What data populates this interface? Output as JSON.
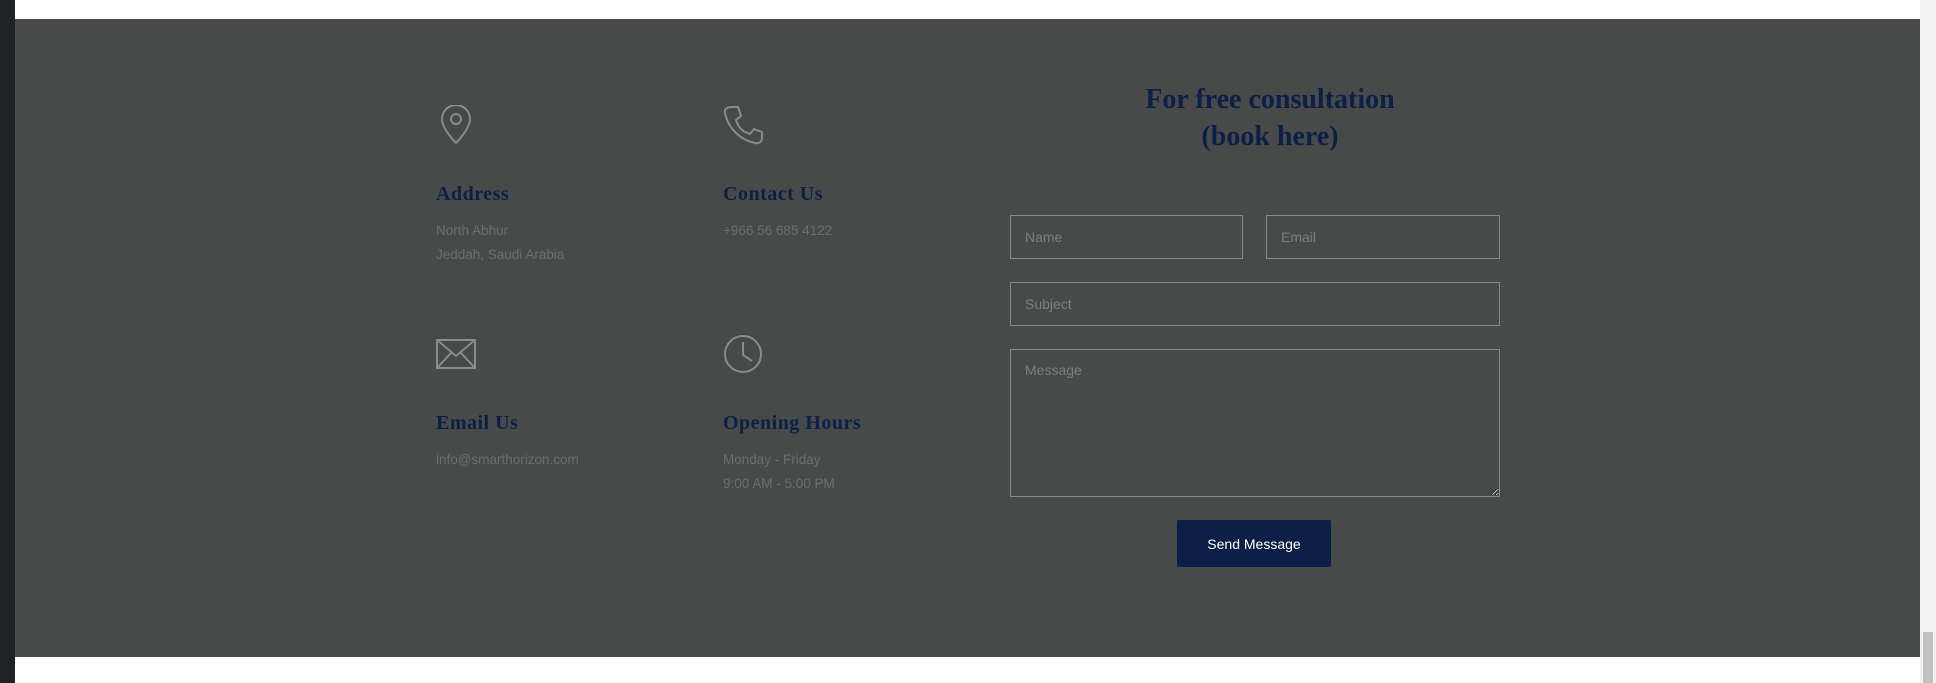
{
  "contact": {
    "address": {
      "icon": "location-pin-icon",
      "title": "Address",
      "lines": [
        "North Abhur",
        "Jeddah, Saudi Arabia"
      ]
    },
    "phone": {
      "icon": "phone-icon",
      "title": "Contact Us",
      "lines": [
        "+966 56 685 4122"
      ]
    },
    "email": {
      "icon": "envelope-icon",
      "title": "Email Us",
      "lines": [
        "info@smarthorizon.com"
      ]
    },
    "hours": {
      "icon": "clock-icon",
      "title": "Opening Hours",
      "lines": [
        "Monday - Friday",
        "9:00 AM - 5:00 PM"
      ]
    }
  },
  "form": {
    "title_line1": "For free consultation",
    "title_line2": "(book here)",
    "name_placeholder": "Name",
    "email_placeholder": "Email",
    "subject_placeholder": "Subject",
    "message_placeholder": "Message",
    "submit_label": "Send Message"
  },
  "colors": {
    "section_background": "#484a49",
    "heading": "#0c1f47",
    "button": "#0c1f47",
    "muted_text": "#6c6e6d",
    "icon": "#8a8c8b"
  }
}
